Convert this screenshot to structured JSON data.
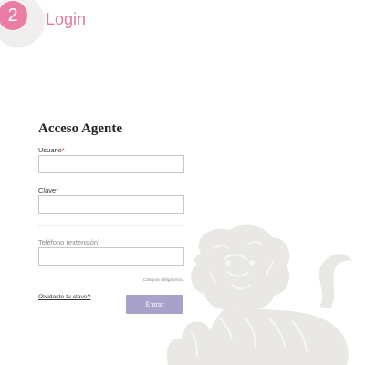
{
  "step": {
    "number": "2",
    "title": "Login"
  },
  "form": {
    "title": "Acceso Agente",
    "username": {
      "label": "Usuario",
      "required_mark": "*",
      "value": ""
    },
    "password": {
      "label": "Clave",
      "required_mark": "*",
      "value": ""
    },
    "phone": {
      "label": "Teléfono (extensión)",
      "value": ""
    },
    "required_note": {
      "mark": "*",
      "text": " Campos obligatorios."
    },
    "forgot_label": "Olvidaste tu clave?",
    "submit_label": "Entrar"
  },
  "colors": {
    "accent_pink": "#e4789f",
    "button": "#a8a2cb",
    "required": "#d9581f"
  },
  "background": {
    "icon": "lion-watermark-icon"
  }
}
